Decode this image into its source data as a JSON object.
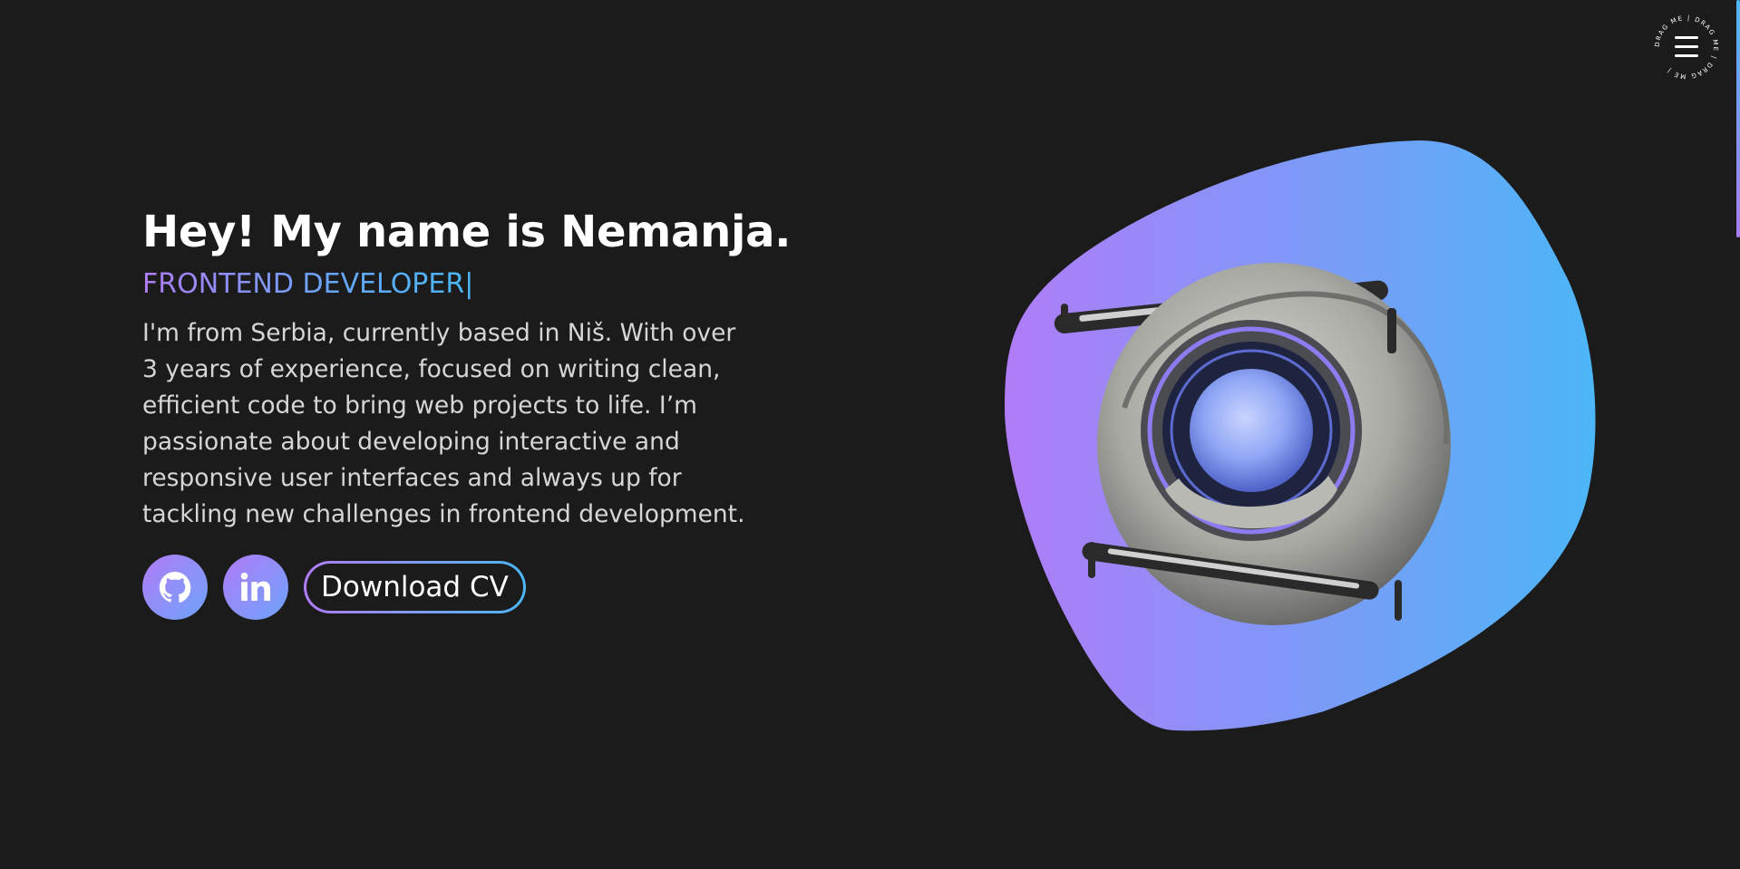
{
  "menu": {
    "ring_text": "DRAG ME | DRAG ME | DRAG ME | ",
    "icon": "hamburger-icon"
  },
  "hero": {
    "title": "Hey! My name is Nemanja.",
    "subtitle": "FRONTEND DEVELOPER",
    "cursor": "|",
    "description": "I'm from Serbia, currently based in Niš. With over 3 years of experience, focused on writing clean, efficient code to bring web projects to life. I’m passionate about developing interactive and responsive user interfaces and always up for tackling new challenges in frontend development.",
    "social": [
      {
        "name": "GitHub",
        "icon": "github-icon"
      },
      {
        "name": "LinkedIn",
        "icon": "linkedin-icon"
      }
    ],
    "cv_button": "Download CV"
  },
  "colors": {
    "background": "#1b1b1b",
    "gradient_start": "#b07cf7",
    "gradient_end": "#4cb6f7",
    "text_primary": "#ffffff",
    "text_secondary": "#d6d6d6"
  },
  "visual": {
    "subject": "robot-sphere-image"
  }
}
